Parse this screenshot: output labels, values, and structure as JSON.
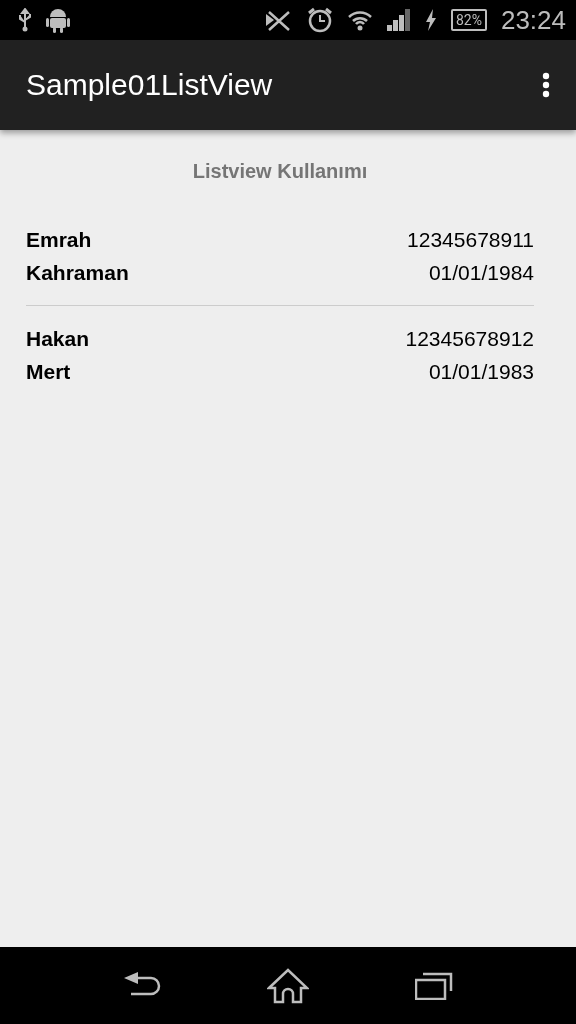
{
  "status_bar": {
    "battery": "82%",
    "time": "23:24"
  },
  "app_bar": {
    "title": "Sample01ListView"
  },
  "header": "Listview Kullanımı",
  "rows": [
    {
      "name": "Emrah",
      "surname": "Kahraman",
      "number": "12345678911",
      "date": "01/01/1984"
    },
    {
      "name": "Hakan",
      "surname": "Mert",
      "number": "12345678912",
      "date": "01/01/1983"
    }
  ]
}
